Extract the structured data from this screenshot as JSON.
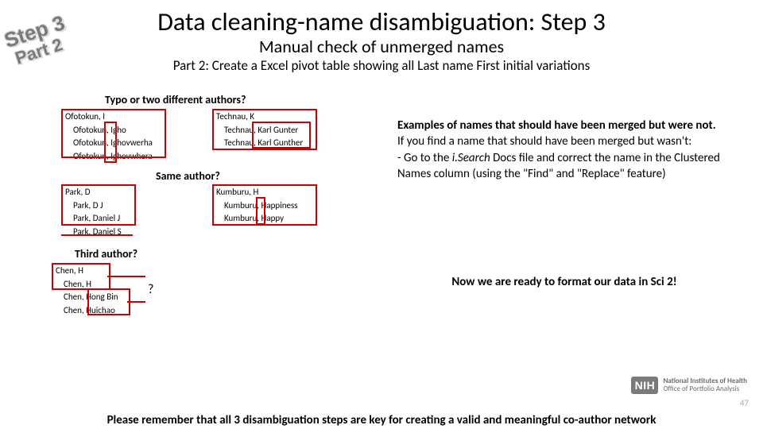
{
  "stamp": {
    "line1": "Step 3",
    "line2": "Part 2"
  },
  "title": "Data cleaning-name disambiguation: Step 3",
  "subtitle": "Manual check of unmerged names",
  "part2": "Part 2: Create a Excel pivot table showing all Last name First initial variations",
  "labels": {
    "typo": "Typo or two different authors?",
    "same": "Same author?",
    "third": "Third author?",
    "question": "?"
  },
  "lists": {
    "ofotokun": {
      "head": "Ofotokun, I",
      "subs": [
        "Ofotokun, Igho",
        "Ofotokun, Ighovwerha",
        "Ofotokun, Ighovwhera"
      ]
    },
    "technau": {
      "head": "Technau, K",
      "subs": [
        "Technau, Karl Gunter",
        "Technau, Karl Gunther"
      ]
    },
    "park": {
      "head": "Park, D",
      "subs": [
        "Park, D J",
        "Park, Daniel J",
        "Park, Daniel S"
      ]
    },
    "kumburu": {
      "head": "Kumburu, H",
      "subs": [
        "Kumburu, Happiness",
        "Kumburu, Happy"
      ]
    },
    "chen": {
      "head": "Chen, H",
      "subs": [
        "Chen, H",
        "Chen, Hong Bin",
        "Chen, Huichao"
      ]
    }
  },
  "right": {
    "l1": "Examples of names that should have been merged but were not.",
    "l2": "If you find a name that should have been merged but wasn't:",
    "b1a": "-  Go to the ",
    "b1b": "i.Search",
    "b1c": " Docs file and correct the name in the Clustered Names column (using the \"Find\" and \"Replace\" feature)"
  },
  "ready": "Now we are ready to format our data in Sci 2!",
  "nih": {
    "badge": "NIH",
    "t1": "National Institutes of Health",
    "t2": "Office of Portfolio Analysis"
  },
  "pagenum": "47",
  "footer": "Please remember that all 3 disambiguation steps are key for creating a valid and meaningful co-author network"
}
